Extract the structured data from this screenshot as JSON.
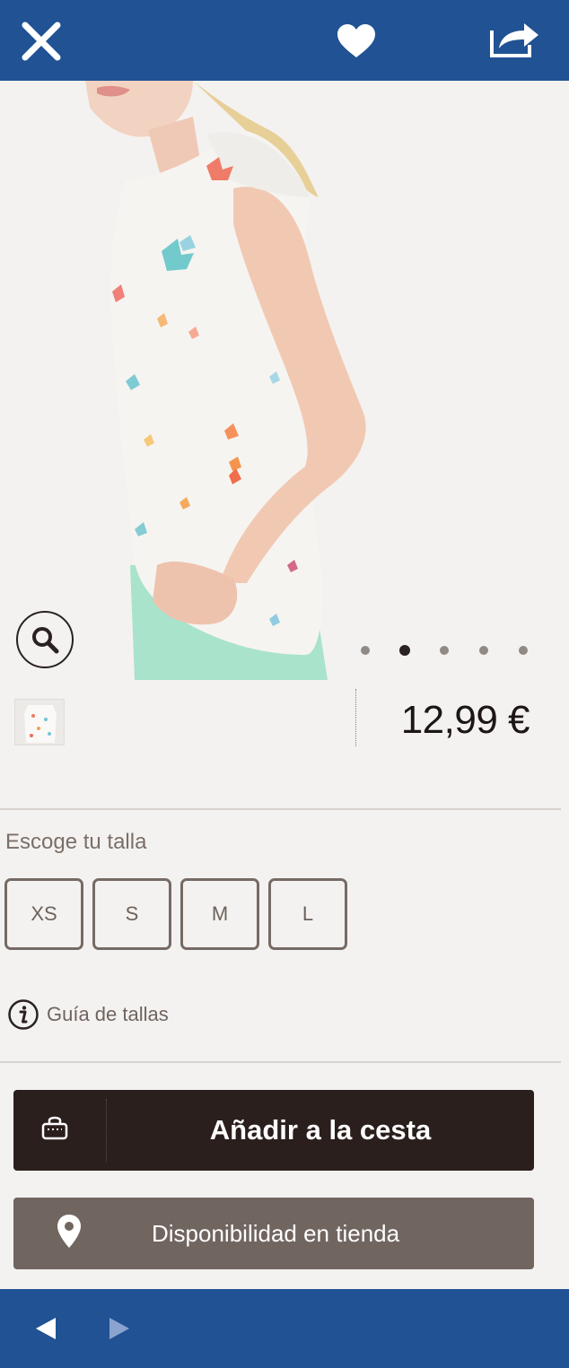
{
  "topbar": {
    "close_icon": "close-icon",
    "favorite_icon": "heart-icon",
    "share_icon": "share-icon",
    "background": "#205294"
  },
  "gallery": {
    "zoom_icon": "search-icon",
    "image_count": 5,
    "active_index": 1
  },
  "product": {
    "price": "12,99 €"
  },
  "size_selector": {
    "title": "Escoge tu talla",
    "sizes": [
      "XS",
      "S",
      "M",
      "L"
    ]
  },
  "size_guide": {
    "label": "Guía de tallas",
    "icon": "info-icon"
  },
  "actions": {
    "add_to_cart": "Añadir a la cesta",
    "add_to_cart_icon": "shopping-bag-icon",
    "store_availability": "Disponibilidad en tienda",
    "store_availability_icon": "map-pin-icon"
  },
  "bottom_nav": {
    "back_icon": "triangle-left-icon",
    "forward_icon": "triangle-right-icon"
  },
  "colors": {
    "brand_blue": "#205294",
    "dark_button": "#2a1f1c",
    "secondary_button": "#716560",
    "background": "#f4f2f0"
  }
}
